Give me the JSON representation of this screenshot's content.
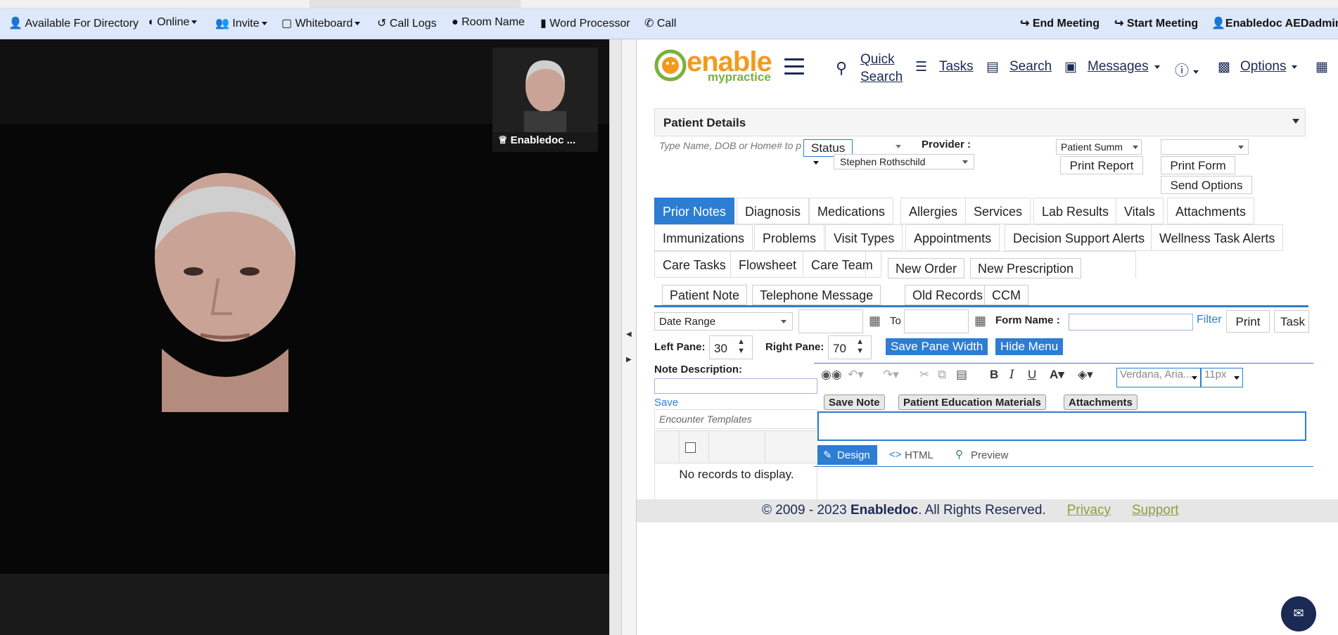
{
  "meeting_bar": {
    "directory": "Available For Directory",
    "online": "Online",
    "invite": "Invite",
    "whiteboard": "Whiteboard",
    "call_logs": "Call Logs",
    "room_name": "Room Name",
    "word_processor": "Word Processor",
    "call": "Call",
    "end_meeting": "End Meeting",
    "start_meeting": "Start Meeting",
    "user": "Enabledoc AEDadmin"
  },
  "video": {
    "thumb_name": "Enabledoc ..."
  },
  "app": {
    "logo_text": "enable",
    "logo_sub": "mypractice",
    "nav": {
      "quick_search_1": "Quick",
      "quick_search_2": "Search",
      "tasks": "Tasks",
      "search": "Search",
      "messages": "Messages",
      "options": "Options"
    },
    "patient_details": {
      "title": "Patient Details",
      "search_placeholder": "Type Name, DOB or Home# to p",
      "status": "Status",
      "provider_label": "Provider :",
      "provider_value": "Stephen   Rothschild",
      "summary_select": "Patient Summ",
      "print_report": "Print Report",
      "print_form": "Print Form",
      "send_options": "Send Options"
    },
    "tabs": {
      "prior_notes": "Prior Notes",
      "diagnosis": "Diagnosis",
      "medications": "Medications",
      "allergies": "Allergies",
      "services": "Services",
      "lab_results": "Lab Results",
      "vitals": "Vitals",
      "attachments": "Attachments",
      "immunizations": "Immunizations",
      "problems": "Problems",
      "visit_types": "Visit Types",
      "appointments": "Appointments",
      "decision_support": "Decision Support Alerts",
      "wellness": "Wellness Task Alerts",
      "care_tasks": "Care Tasks",
      "flowsheet": "Flowsheet",
      "care_team": "Care Team",
      "new_order": "New Order",
      "new_prescription": "New Prescription",
      "patient_note": "Patient Note",
      "telephone_message": "Telephone Message",
      "old_records": "Old Records",
      "ccm": "CCM"
    },
    "filters": {
      "date_range": "Date Range",
      "to": "To",
      "form_name_label": "Form Name :",
      "filter_link": "Filter",
      "print": "Print",
      "tasks": "Task"
    },
    "panes": {
      "left_label": "Left Pane:",
      "left_value": "30",
      "right_label": "Right Pane:",
      "right_value": "70",
      "save_width": "Save Pane Width",
      "hide_menu": "Hide Menu"
    },
    "notes": {
      "description_label": "Note Description:",
      "save_link": "Save",
      "encounter_placeholder": "Encounter Templates",
      "no_records": "No records to display."
    },
    "editor": {
      "font_family": "Verdana, Aria...",
      "font_size": "11px",
      "save_note": "Save Note",
      "patient_education": "Patient Education Materials",
      "attachments": "Attachments",
      "mode_design": "Design",
      "mode_html": "HTML",
      "mode_preview": "Preview"
    },
    "footer": {
      "copyright_prefix": "© 2009 - 2023 ",
      "brand": "Enabledoc",
      "copyright_suffix": ". All Rights Reserved.",
      "privacy": "Privacy",
      "support": "Support"
    }
  },
  "colors": {
    "meeting_bar_bg": "#dde8fb",
    "accent_blue": "#2d7dd2",
    "brand_orange": "#f39a1e",
    "brand_green": "#7ab13c",
    "navy": "#1b2a55"
  }
}
